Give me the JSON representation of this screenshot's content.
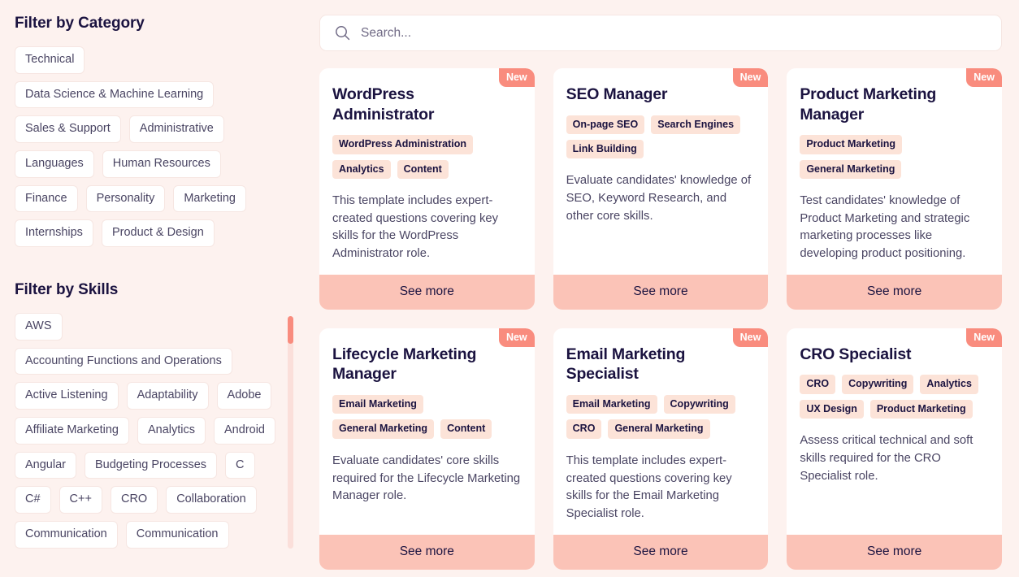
{
  "sidebar": {
    "category": {
      "heading": "Filter by Category",
      "items": [
        "Technical",
        "Data Science & Machine Learning",
        "Sales & Support",
        "Administrative",
        "Languages",
        "Human Resources",
        "Finance",
        "Personality",
        "Marketing",
        "Internships",
        "Product & Design"
      ]
    },
    "skills": {
      "heading": "Filter by Skills",
      "items": [
        "AWS",
        "Accounting Functions and Operations",
        "Active Listening",
        "Adaptability",
        "Adobe",
        "Affiliate Marketing",
        "Analytics",
        "Android",
        "Angular",
        "Budgeting Processes",
        "C",
        "C#",
        "C++",
        "CRO",
        "Collaboration",
        "Communication",
        "Communication"
      ]
    }
  },
  "search": {
    "placeholder": "Search...",
    "value": "",
    "icon": "search-icon"
  },
  "cards": [
    {
      "title": "WordPress Administrator",
      "badge": "New",
      "tags": [
        "WordPress Administration",
        "Analytics",
        "Content"
      ],
      "description": "This template includes expert-created questions covering key skills for the WordPress Administrator role.",
      "action": "See more"
    },
    {
      "title": "SEO Manager",
      "badge": "New",
      "tags": [
        "On-page SEO",
        "Search Engines",
        "Link Building"
      ],
      "description": "Evaluate candidates' knowledge of SEO, Keyword Research, and other core skills.",
      "action": "See more"
    },
    {
      "title": "Product Marketing Manager",
      "badge": "New",
      "tags": [
        "Product Marketing",
        "General Marketing"
      ],
      "description": "Test candidates' knowledge of Product Marketing and strategic marketing processes like developing product positioning.",
      "action": "See more"
    },
    {
      "title": "Lifecycle Marketing Manager",
      "badge": "New",
      "tags": [
        "Email Marketing",
        "General Marketing",
        "Content"
      ],
      "description": "Evaluate candidates' core skills required for the Lifecycle Marketing Manager role.",
      "action": "See more"
    },
    {
      "title": "Email Marketing Specialist",
      "badge": "New",
      "tags": [
        "Email Marketing",
        "Copywriting",
        "CRO",
        "General Marketing"
      ],
      "description": "This template includes expert-created questions covering key skills for the Email Marketing Specialist role.",
      "action": "See more"
    },
    {
      "title": "CRO Specialist",
      "badge": "New",
      "tags": [
        "CRO",
        "Copywriting",
        "Analytics",
        "UX Design",
        "Product Marketing"
      ],
      "description": "Assess critical technical and soft skills required for the CRO Specialist role.",
      "action": "See more"
    }
  ],
  "colors": {
    "page_background": "#fdf2ef",
    "card_background": "#ffffff",
    "accent": "#f98c7e",
    "see_more_background": "#fbc3b7",
    "tag_background": "#fce3d8",
    "text_dark": "#1b1340",
    "text_muted": "#4a4563",
    "scrollbar_track": "#fbdfda"
  }
}
